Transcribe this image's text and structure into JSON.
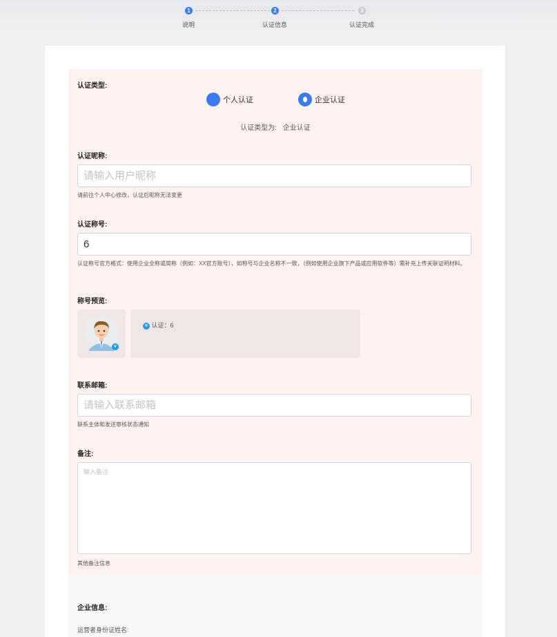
{
  "steps": [
    {
      "num": "1",
      "label": "说明",
      "state": "done"
    },
    {
      "num": "2",
      "label": "认证信息",
      "state": "active"
    },
    {
      "num": "3",
      "label": "认证完成",
      "state": "inactive"
    }
  ],
  "form": {
    "type_label": "认证类型:",
    "options": [
      {
        "label": "个人认证",
        "checked": false
      },
      {
        "label": "企业认证",
        "checked": true
      }
    ],
    "type_result_prefix": "认证类型为:",
    "type_result_value": "企业认证",
    "nickname": {
      "label": "认证昵称:",
      "placeholder": "请输入用户昵称",
      "value": "",
      "hint": "请前往个人中心修改，认证后昵称无法变更"
    },
    "title": {
      "label": "认证称号:",
      "value": "6",
      "hint": "认证称号官方格式：使用企业全称或简称（例如：XX官方账号），如称号与企业名称不一致，（例如使用企业旗下产品或应用软件等）需补充上传关联证明材料。"
    },
    "preview": {
      "label": "称号预览:",
      "text": "认证：6"
    },
    "email": {
      "label": "联系邮箱:",
      "placeholder": "请输入联系邮箱",
      "value": "",
      "hint": "联系主体和发送审核状态通知"
    },
    "remark": {
      "label": "备注:",
      "placeholder": "输入备注",
      "hint": "其他备注信息"
    }
  },
  "company": {
    "label": "企业信息:",
    "operator_label": "运营者身份证姓名:"
  },
  "colors": {
    "accent": "#3a7af2",
    "panel_bg": "#fff3f2",
    "verified_badge": "#1d9bf0"
  }
}
